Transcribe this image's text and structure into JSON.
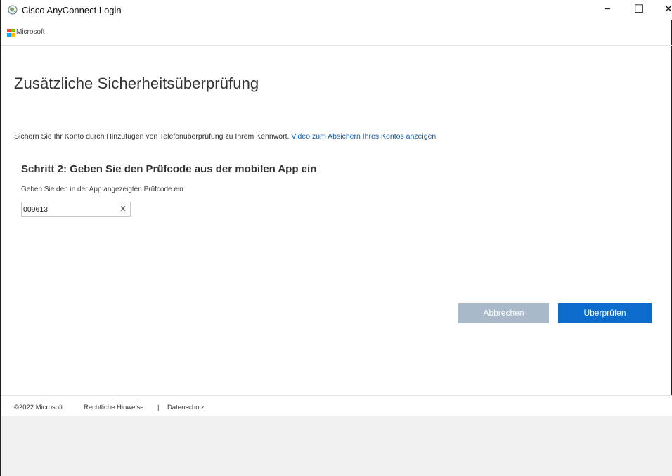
{
  "window": {
    "title": "Cisco AnyConnect Login",
    "minimize_symbol": "−",
    "maximize_symbol": "☐",
    "close_symbol": "✕"
  },
  "brand": {
    "name": "Microsoft",
    "logo_colors": [
      "#f25022",
      "#7fba00",
      "#00a4ef",
      "#ffb900"
    ]
  },
  "main": {
    "title": "Zusätzliche Sicherheitsüberprüfung",
    "description": "Sichern Sie Ihr Konto durch Hinzufügen von Telefonüberprüfung zu Ihrem Kennwort.",
    "video_link": "Video zum Absichern Ihres Kontos anzeigen",
    "step_heading": "Schritt 2: Geben Sie den Prüfcode aus der mobilen App ein",
    "field_label": "Geben Sie den in der App angezeigten Prüfcode ein",
    "code_value": "009613",
    "clear_symbol": "✕"
  },
  "buttons": {
    "cancel": "Abbrechen",
    "verify": "Überprüfen",
    "cancel_color": "#a9b9c9",
    "verify_color": "#0d6ccb"
  },
  "footer": {
    "copyright": "©2022 Microsoft",
    "legal": "Rechtliche Hinweise",
    "separator": "|",
    "privacy": "Datenschutz"
  }
}
